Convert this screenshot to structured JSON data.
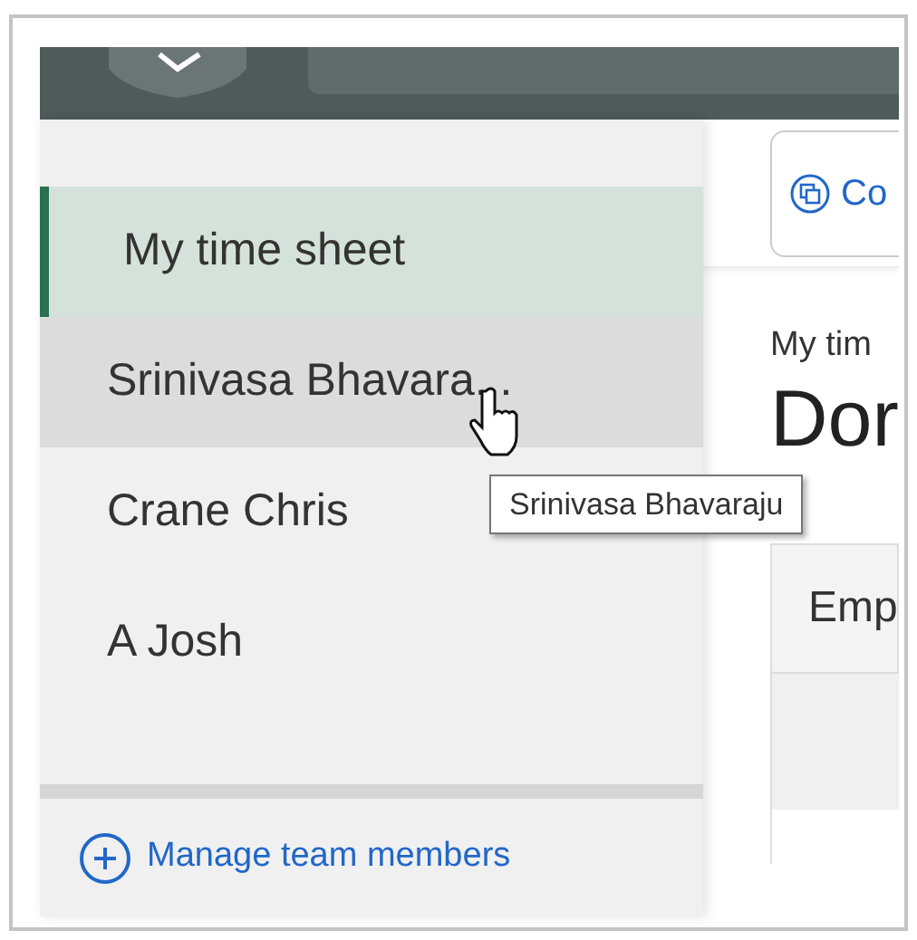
{
  "sidebar": {
    "items": [
      {
        "label": "My time sheet",
        "selected": true,
        "hovered": false
      },
      {
        "label": "Srinivasa Bhavara...",
        "selected": false,
        "hovered": true
      },
      {
        "label": "Crane Chris",
        "selected": false,
        "hovered": false
      },
      {
        "label": "A Josh",
        "selected": false,
        "hovered": false
      }
    ],
    "footer_link": "Manage team members"
  },
  "tooltip": "Srinivasa Bhavaraju",
  "main": {
    "button": "Co",
    "breadcrumb": "My tim",
    "heading": "Dor",
    "table": {
      "columns": [
        "Emp"
      ]
    }
  }
}
